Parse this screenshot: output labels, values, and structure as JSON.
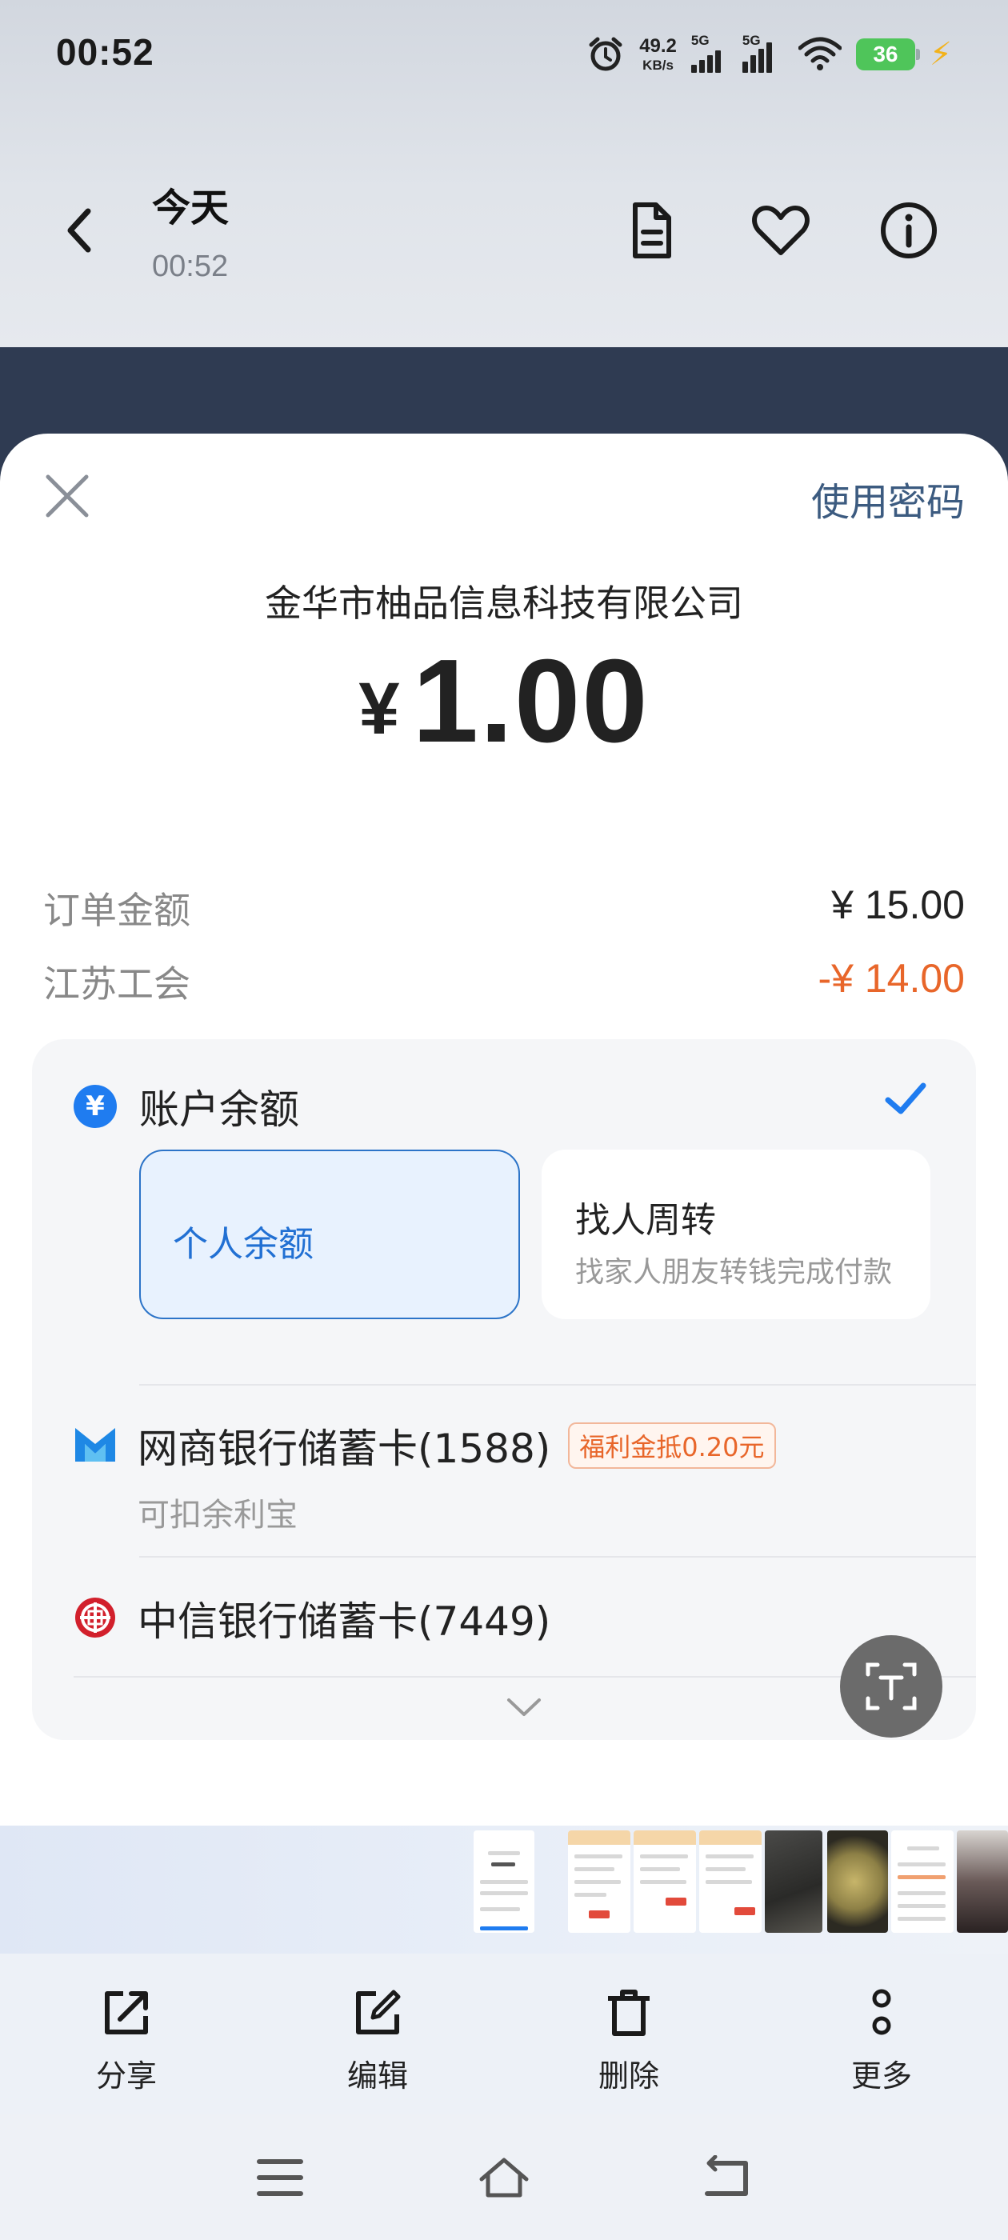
{
  "status_bar": {
    "time": "00:52",
    "net_speed_value": "49.2",
    "net_speed_unit": "KB/s",
    "signal1_label": "5G",
    "signal2_label": "5G",
    "battery": "36",
    "icons": [
      "alarm-icon",
      "signal-icon",
      "wifi-icon",
      "battery-icon",
      "charging-icon"
    ]
  },
  "header": {
    "title": "今天",
    "subtitle": "00:52",
    "icons": [
      "back-icon",
      "document-icon",
      "heart-icon",
      "info-icon"
    ]
  },
  "payment_sheet": {
    "use_password_label": "使用密码",
    "merchant": "金华市柚品信息科技有限公司",
    "currency_symbol": "¥",
    "amount": "1.00",
    "order_amount_label": "订单金额",
    "order_amount_value": "¥ 15.00",
    "discount_label": "江苏工会",
    "discount_value": "-¥ 14.00",
    "accent_color": "#1f7cf0",
    "discount_color": "#e8662a"
  },
  "payment_methods": {
    "balance_label": "账户余额",
    "balance_icon": "¥",
    "option_personal": "个人余额",
    "option_friend_title": "找人周转",
    "option_friend_subtitle": "找家人朋友转钱完成付款",
    "banks": [
      {
        "name": "网商银行储蓄卡(1588)",
        "tag": "福利金抵0.20元",
        "sub": "可扣余利宝",
        "icon": "mybank-icon"
      },
      {
        "name": "中信银行储蓄卡(7449)",
        "icon": "citic-bank-icon"
      }
    ]
  },
  "action_bar": {
    "share": "分享",
    "edit": "编辑",
    "delete": "删除",
    "more": "更多"
  }
}
